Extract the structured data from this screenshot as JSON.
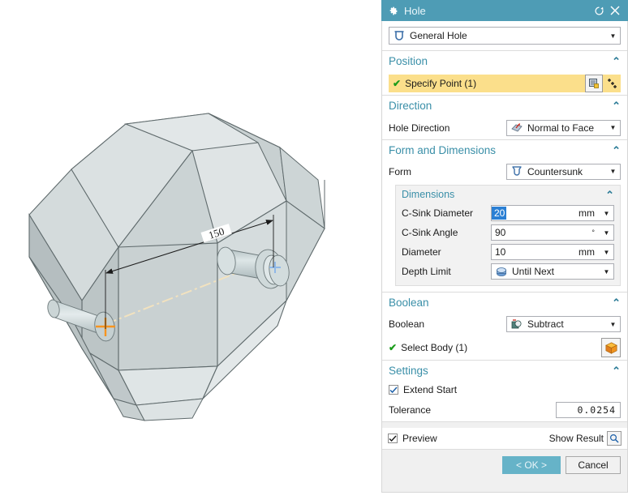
{
  "dialog": {
    "title": "Hole",
    "title_icon": "gear-icon",
    "reset_icon": "reset-icon",
    "close_icon": "close-icon",
    "type_combo": {
      "value": "General Hole",
      "icon": "hole-type-icon"
    },
    "position": {
      "heading": "Position",
      "collapse_icon": "chevron-up-icon",
      "specify_point": {
        "label": "Specify Point (1)",
        "status_icon": "green-check-icon",
        "point_dialog_icon": "point-dialog-icon",
        "sketch_point_icon": "sketch-point-icon"
      }
    },
    "direction": {
      "heading": "Direction",
      "collapse_icon": "chevron-up-icon",
      "hole_direction_label": "Hole Direction",
      "hole_direction_value": "Normal to Face",
      "hole_direction_icon": "normal-to-face-icon"
    },
    "form_and_dimensions": {
      "heading": "Form and Dimensions",
      "collapse_icon": "chevron-up-icon",
      "form_label": "Form",
      "form_value": "Countersunk",
      "form_icon": "countersunk-icon",
      "dimensions": {
        "heading": "Dimensions",
        "collapse_icon": "chevron-up-icon",
        "rows": [
          {
            "label": "C-Sink Diameter",
            "value": "20",
            "unit": "mm",
            "selected": true,
            "icon": ""
          },
          {
            "label": "C-Sink Angle",
            "value": "90",
            "unit": "°",
            "selected": false,
            "icon": ""
          },
          {
            "label": "Diameter",
            "value": "10",
            "unit": "mm",
            "selected": false,
            "icon": ""
          }
        ],
        "depth_limit_label": "Depth Limit",
        "depth_limit_value": "Until Next",
        "depth_limit_icon": "until-next-icon"
      }
    },
    "boolean": {
      "heading": "Boolean",
      "collapse_icon": "chevron-up-icon",
      "boolean_label": "Boolean",
      "boolean_value": "Subtract",
      "boolean_icon": "subtract-icon",
      "select_body_label": "Select Body (1)",
      "select_body_status_icon": "green-check-icon",
      "select_body_icon": "body-cube-icon"
    },
    "settings": {
      "heading": "Settings",
      "collapse_icon": "chevron-up-icon",
      "extend_start_label": "Extend Start",
      "extend_start_checked": true,
      "tolerance_label": "Tolerance",
      "tolerance_value": "0.0254"
    },
    "footer": {
      "preview_label": "Preview",
      "preview_checked": true,
      "show_result_label": "Show Result",
      "show_result_icon": "magnifier-icon",
      "ok_label": "< OK >",
      "cancel_label": "Cancel"
    }
  },
  "viewport": {
    "dimension_label": "150",
    "center_marker_icon": "orange-cross-marker",
    "point_marker_icon": "blue-cross-marker",
    "colors": {
      "face_light": "#dfe4e5",
      "face_mid": "#ced5d6",
      "face_dark": "#b9c1c2",
      "edge": "#5f6a6c",
      "preview_cylinder": "#c3cfd1",
      "axis_line": "#f2e2bf",
      "marker_orange": "#f7941e",
      "marker_blue": "#8fb8e8"
    }
  },
  "theme": {
    "accent": "#4e9cb5",
    "heading_text": "#3a8fa8",
    "selection_yellow": "#fbdf8b",
    "selection_blue": "#2a7fd4",
    "panel_bg": "#f0f0f0"
  }
}
